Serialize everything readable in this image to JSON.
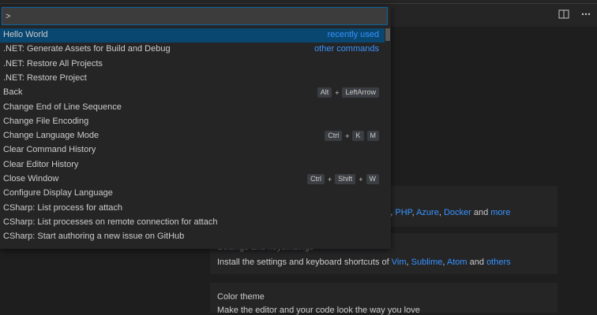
{
  "command_palette": {
    "input_value": ">",
    "items": [
      {
        "label": "Hello World",
        "meta": "recently used",
        "keys": []
      },
      {
        "label": ".NET: Generate Assets for Build and Debug",
        "meta": "other commands",
        "keys": []
      },
      {
        "label": ".NET: Restore All Projects",
        "meta": "",
        "keys": []
      },
      {
        "label": ".NET: Restore Project",
        "meta": "",
        "keys": []
      },
      {
        "label": "Back",
        "meta": "",
        "keys": [
          "Alt",
          "LeftArrow"
        ]
      },
      {
        "label": "Change End of Line Sequence",
        "meta": "",
        "keys": []
      },
      {
        "label": "Change File Encoding",
        "meta": "",
        "keys": []
      },
      {
        "label": "Change Language Mode",
        "meta": "",
        "keys": [
          "Ctrl",
          "K",
          "M"
        ]
      },
      {
        "label": "Clear Command History",
        "meta": "",
        "keys": []
      },
      {
        "label": "Clear Editor History",
        "meta": "",
        "keys": []
      },
      {
        "label": "Close Window",
        "meta": "",
        "keys": [
          "Ctrl",
          "Shift",
          "W"
        ]
      },
      {
        "label": "Configure Display Language",
        "meta": "",
        "keys": []
      },
      {
        "label": "CSharp: List process for attach",
        "meta": "",
        "keys": []
      },
      {
        "label": "CSharp: List processes on remote connection for attach",
        "meta": "",
        "keys": []
      },
      {
        "label": "CSharp: Start authoring a new issue on GitHub",
        "meta": "",
        "keys": []
      }
    ]
  },
  "welcome": {
    "languages_panel": {
      "partial_prefix": "on, ",
      "links": [
        "PHP",
        "Azure",
        "Docker"
      ],
      "and_text": "and",
      "more_link": "more"
    },
    "settings_panel": {
      "title_partial": "Settings and keybindings",
      "desc_prefix": "Install the settings and keyboard shortcuts of",
      "links": [
        "Vim",
        "Sublime",
        "Atom"
      ],
      "and_text": "and",
      "others_link": "others"
    },
    "theme_panel": {
      "title": "Color theme",
      "desc": "Make the editor and your code look the way you love"
    }
  },
  "editor_actions": [
    {
      "icon": "split-editor-icon"
    },
    {
      "icon": "more-actions-icon"
    }
  ],
  "colors": {
    "accent": "#0e639c",
    "link": "#3794ff",
    "selection": "#094771"
  }
}
